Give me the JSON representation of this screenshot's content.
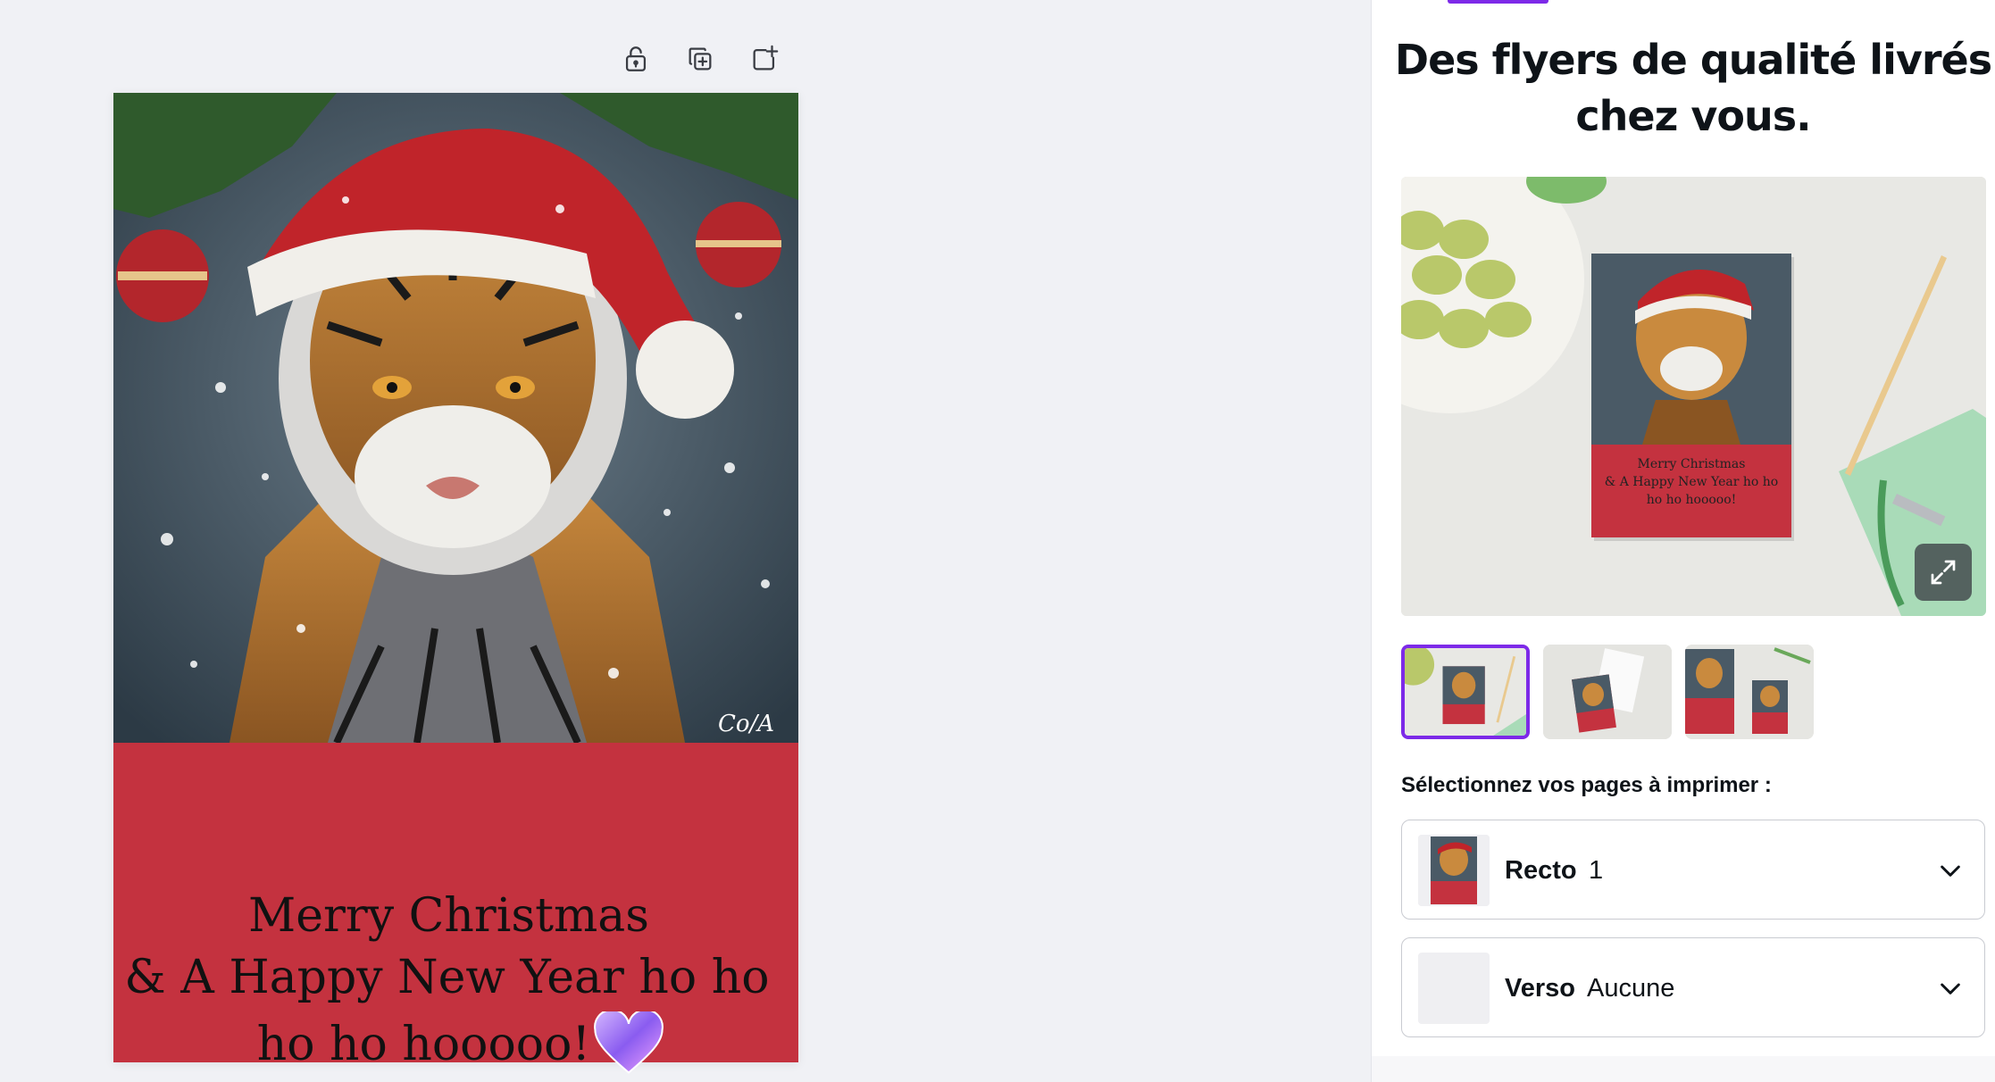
{
  "toolbar": {
    "icons": [
      "lock-open-icon",
      "duplicate-page-icon",
      "add-page-icon"
    ]
  },
  "card": {
    "line1": "Merry Christmas",
    "line2": "& A Happy New Year ho ho",
    "line3": "ho ho hooooo!",
    "signature": "Co/A",
    "background_color": "#c4323f"
  },
  "panel": {
    "title_line1": "Des flyers de qualité livrés",
    "title_line2": "chez vous.",
    "accent_color": "#7d2ae8",
    "preview": {
      "card_text_line1": "Merry Christmas",
      "card_text_line2": "& A Happy New Year ho ho",
      "card_text_line3": "ho ho hooooo!"
    },
    "thumbnails": [
      "Mockup 1",
      "Mockup 2",
      "Mockup 3"
    ],
    "select_label": "Sélectionnez vos pages à imprimer :",
    "pages": [
      {
        "name": "Recto",
        "value": "1"
      },
      {
        "name": "Verso",
        "value": "Aucune"
      }
    ]
  }
}
